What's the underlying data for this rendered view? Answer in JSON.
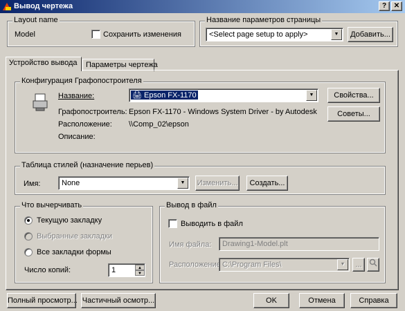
{
  "window": {
    "title": "Вывод чертежа",
    "help_button": "?",
    "close_button": "✕"
  },
  "layout": {
    "group_label": "Layout name",
    "name": "Model",
    "save_changes_label": "Сохранить изменения",
    "save_changes_checked": false
  },
  "page_setup": {
    "group_label": "Название параметров страницы",
    "combo_value": "<Select page setup to apply>",
    "add_button": "Добавить..."
  },
  "tabs": [
    {
      "label": "Устройство вывода",
      "active": true
    },
    {
      "label": "Параметры чертежа",
      "active": false
    }
  ],
  "plotter_config": {
    "group_label": "Конфигурация Графопостроителя",
    "name_label": "Название:",
    "name_value": "Epson FX-1170",
    "properties_button": "Свойства...",
    "hints_button": "Советы...",
    "plotter_label": "Графопостроитель:",
    "plotter_value": "Epson FX-1170 - Windows System Driver - by Autodesk",
    "location_label": "Расположение:",
    "location_value": "\\\\Comp_02\\epson",
    "description_label": "Описание:",
    "description_value": ""
  },
  "style_table": {
    "group_label": "Таблица стилей (назначение перьев)",
    "name_label": "Имя:",
    "name_value": "None",
    "edit_button": "Изменить...",
    "create_button": "Создать..."
  },
  "what_to_plot": {
    "group_label": "Что вычерчивать",
    "options": [
      {
        "label": "Текущую закладку",
        "selected": true,
        "enabled": true
      },
      {
        "label": "Выбранные закладки",
        "selected": false,
        "enabled": false
      },
      {
        "label": "Все закладки формы",
        "selected": false,
        "enabled": true
      }
    ],
    "copies_label": "Число копий:",
    "copies_value": "1"
  },
  "plot_to_file": {
    "group_label": "Вывод в файл",
    "checkbox_label": "Выводить в файл",
    "checked": false,
    "filename_label": "Имя файла:",
    "filename_value": "Drawing1-Model.plt",
    "location_label": "Расположение:",
    "location_value": "C:\\Program Files\\",
    "browse_button": "..."
  },
  "footer": {
    "full_preview": "Полный просмотр...",
    "partial_preview": "Частичный осмотр...",
    "ok": "OK",
    "cancel": "Отмена",
    "help": "Справка"
  }
}
